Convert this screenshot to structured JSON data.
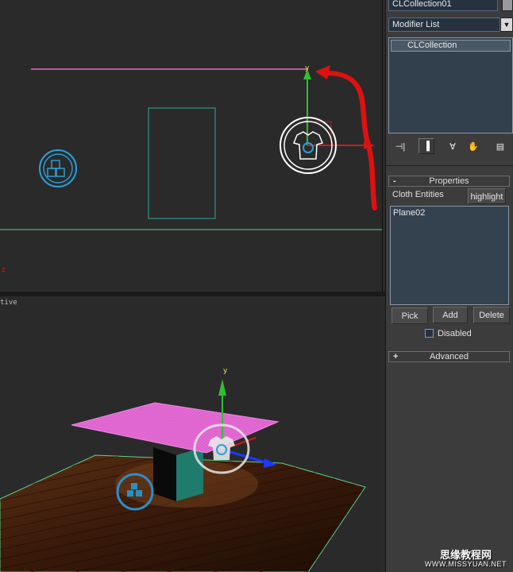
{
  "viewports": {
    "perspective_label": "tive",
    "top_gizmo_axis": "y",
    "persp_gizmo_axis": "y",
    "top_corner_axis": "z",
    "shirt_icon_letter": "C"
  },
  "command_panel": {
    "object_name": "CLCollection01",
    "modifier_list": "Modifier List",
    "stack_item": "CLCollection",
    "toolbar_icons": [
      "pin-stack-icon",
      "show-end-result-icon",
      "make-unique-icon",
      "remove-modifier-icon",
      "configure-sets-icon"
    ]
  },
  "properties": {
    "rollout_title": "Properties",
    "rollout_sign": "-",
    "entities_label": "Cloth Entities",
    "highlight_label": "highlight",
    "entities": [
      "Plane02"
    ],
    "pick_label": "Pick",
    "add_label": "Add",
    "delete_label": "Delete",
    "disabled_label": "Disabled"
  },
  "advanced": {
    "rollout_title": "Advanced",
    "rollout_sign": "+"
  },
  "watermark": {
    "line1": "思缘教程网",
    "line2": "WWW.MISSYUAN.NET"
  },
  "colors": {
    "gizmo_y": "#2fbf2f",
    "gizmo_x": "#cc1a1a",
    "gizmo_z": "#1a3aff",
    "cyan": "#2a9fd6",
    "cloth_pink": "#e46ad4",
    "annotation_red": "#e01010"
  }
}
